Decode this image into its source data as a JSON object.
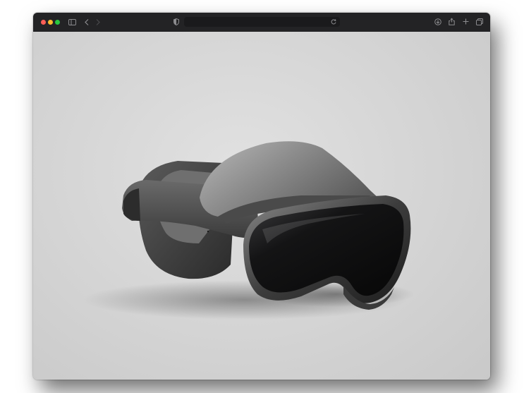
{
  "browser": {
    "address_value": "",
    "address_placeholder": "",
    "traffic_colors": {
      "close": "#ff5f57",
      "minimize": "#febc2e",
      "zoom": "#28c840"
    },
    "icons": {
      "sidebar": "sidebar-toggle-icon",
      "back": "chevron-left-icon",
      "forward": "chevron-right-icon",
      "privacy": "shield-privacy-icon",
      "reload": "reload-icon",
      "downloads": "download-icon",
      "share": "share-icon",
      "new_tab": "plus-icon",
      "tabs": "tab-overview-icon"
    }
  },
  "page": {
    "image": "vr-headset-photo"
  }
}
